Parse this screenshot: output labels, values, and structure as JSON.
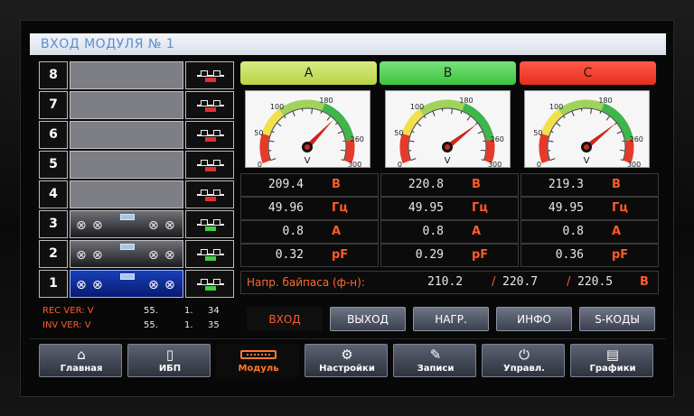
{
  "title": "ВХОД МОДУЛЯ № 1",
  "modules": [
    {
      "num": "8",
      "state": "empty"
    },
    {
      "num": "7",
      "state": "empty"
    },
    {
      "num": "6",
      "state": "empty"
    },
    {
      "num": "5",
      "state": "empty"
    },
    {
      "num": "4",
      "state": "empty"
    },
    {
      "num": "3",
      "state": "active"
    },
    {
      "num": "2",
      "state": "active"
    },
    {
      "num": "1",
      "state": "selected"
    }
  ],
  "phases": {
    "a": "A",
    "b": "B",
    "c": "C"
  },
  "colors": {
    "phase_a": "#c4df5a",
    "phase_b": "#4dcc50",
    "phase_c": "#ef3a26",
    "accent": "#ff5a2a"
  },
  "gauge": {
    "unit": "V",
    "ticks": [
      "0",
      "50",
      "100",
      "180",
      "260",
      "300"
    ],
    "min": 0,
    "max": 300,
    "values": {
      "a": 209.4,
      "b": 220.8,
      "c": 219.3
    }
  },
  "readings": {
    "a": {
      "voltage": "209.4",
      "frequency": "49.96",
      "current": "0.8",
      "pf": "0.32"
    },
    "b": {
      "voltage": "220.8",
      "frequency": "49.95",
      "current": "0.8",
      "pf": "0.29"
    },
    "c": {
      "voltage": "219.3",
      "frequency": "49.95",
      "current": "0.8",
      "pf": "0.36"
    }
  },
  "units": {
    "voltage": "В",
    "frequency": "Гц",
    "current": "А",
    "pf": "pF"
  },
  "bypass": {
    "label": "Напр. байпаса (ф-н):",
    "v1": "210.2",
    "v2": "220.7",
    "v3": "220.5",
    "slash": "/",
    "unit": "В"
  },
  "versions": {
    "rec": {
      "label": "REC VER: V",
      "a": "55.",
      "b": "1.",
      "c": "34"
    },
    "inv": {
      "label": "INV VER: V",
      "a": "55.",
      "b": "1.",
      "c": "35"
    }
  },
  "tabs": {
    "vhod": "ВХОД",
    "vyhod": "ВЫХОД",
    "nagr": "НАГР.",
    "info": "ИНФО",
    "skody": "S-КОДЫ"
  },
  "nav": {
    "glavnaya": "Главная",
    "ibp": "ИБП",
    "modul": "Модуль",
    "nastroyki": "Настройки",
    "zapisi": "Записи",
    "uprav": "Управл.",
    "grafiki": "Графики"
  },
  "icons": {
    "home": "home-icon",
    "ups": "ups-icon",
    "module": "module-icon",
    "settings": "gear-icon",
    "records": "records-icon",
    "control": "power-icon",
    "graphs": "graph-icon"
  }
}
